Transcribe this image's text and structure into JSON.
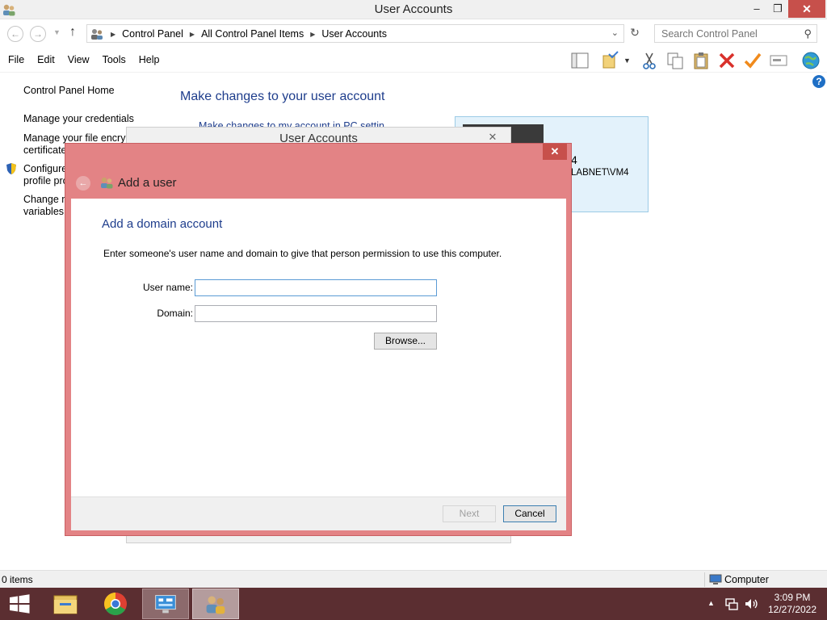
{
  "window": {
    "title": "User Accounts",
    "minimize": "–",
    "restore": "❐",
    "close": "✕"
  },
  "address": {
    "crumbs": [
      "Control Panel",
      "All Control Panel Items",
      "User Accounts"
    ],
    "search_placeholder": "Search Control Panel"
  },
  "menu": [
    "File",
    "Edit",
    "View",
    "Tools",
    "Help"
  ],
  "toolbar_icons": [
    "layout-icon",
    "properties-icon",
    "cut-icon",
    "copy-icon",
    "paste-icon",
    "delete-icon",
    "checkmark-icon",
    "rename-icon",
    "globe-icon"
  ],
  "sidebar": {
    "items": [
      {
        "label": "Control Panel Home"
      },
      {
        "label": "Manage your credentials"
      },
      {
        "label": "Manage your file encryp"
      },
      {
        "label": "certificate"
      },
      {
        "label": "Configure"
      },
      {
        "label": "profile pro"
      },
      {
        "label": "Change m"
      },
      {
        "label": "variables"
      }
    ]
  },
  "main": {
    "heading": "Make changes to your user account",
    "partial_link": "Make changes to my account in PC settings",
    "user_card": {
      "line1": "4",
      "line2": "LABNET\\VM4"
    }
  },
  "bg_dialog": {
    "title": "User Accounts",
    "close": "✕"
  },
  "dialog": {
    "title": "Add a user",
    "close": "✕",
    "subtitle": "Add a domain account",
    "description": "Enter someone's user name and domain to give that person permission to use this computer.",
    "username_label": "User name:",
    "username_value": "",
    "domain_label": "Domain:",
    "domain_value": "",
    "browse": "Browse...",
    "next": "Next",
    "cancel": "Cancel"
  },
  "status": {
    "items": "0 items",
    "location": "Computer"
  },
  "taskbar": {
    "time": "3:09 PM",
    "date": "12/27/2022"
  },
  "colors": {
    "dialog_frame": "#e38385",
    "close_button": "#c7504b",
    "heading_blue": "#1e3d8c",
    "taskbar": "#5b2e31",
    "user_card": "#e3f2fb"
  }
}
